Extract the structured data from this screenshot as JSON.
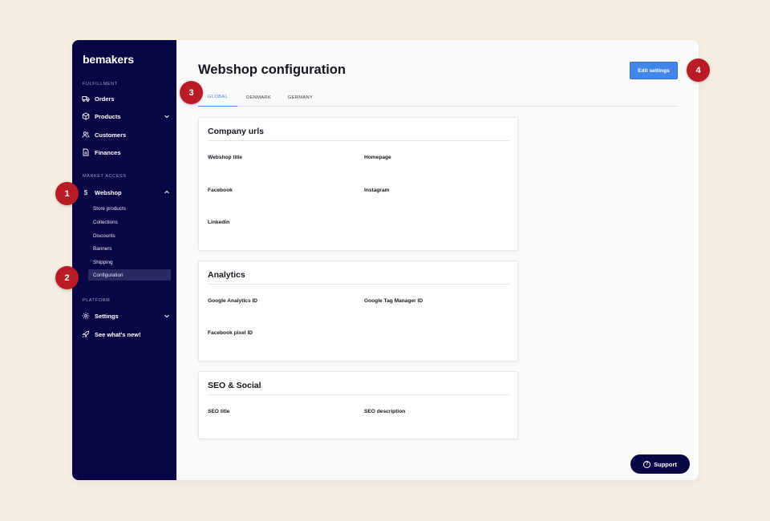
{
  "sidebar": {
    "logo": "bemakers",
    "sections": {
      "fulfillment": "FULFILLMENT",
      "market_access": "MARKET ACCESS",
      "platform": "PLATFORM"
    },
    "items": {
      "orders": {
        "label": "Orders",
        "icon": "truck-icon"
      },
      "products": {
        "label": "Products",
        "icon": "box-icon"
      },
      "customers": {
        "label": "Customers",
        "icon": "users-icon"
      },
      "finances": {
        "label": "Finances",
        "icon": "document-icon"
      },
      "webshop": {
        "label": "Webshop",
        "icon": "dollar-icon"
      },
      "settings": {
        "label": "Settings",
        "icon": "gear-icon"
      },
      "whats_new": {
        "label": "See what's new!",
        "icon": "rocket-icon"
      }
    },
    "webshop_sub": [
      "Store products",
      "Collections",
      "Discounts",
      "Banners",
      "Shipping",
      "Configuration"
    ],
    "active_sub": "Configuration"
  },
  "main": {
    "title": "Webshop configuration",
    "edit_button": "Edit settings",
    "tabs": [
      "GLOBAL",
      "DENMARK",
      "GERMANY"
    ],
    "active_tab": "GLOBAL",
    "cards": {
      "company": {
        "title": "Company urls",
        "fields": [
          "Webshop title",
          "Homepage",
          "Facebook",
          "Instagram",
          "Linkedin"
        ]
      },
      "analytics": {
        "title": "Analytics",
        "fields": [
          "Google Analytics ID",
          "Google Tag Manager ID",
          "Facebook pixel ID"
        ]
      },
      "seo": {
        "title": "SEO & Social",
        "fields": [
          "SEO title",
          "SEO description"
        ]
      }
    },
    "support_button": "Support"
  },
  "markers": [
    "1",
    "2",
    "3",
    "4"
  ],
  "colors": {
    "background": "#f6ede1",
    "sidebar": "#080645",
    "accent": "#4286e9",
    "marker": "#b91c24"
  }
}
